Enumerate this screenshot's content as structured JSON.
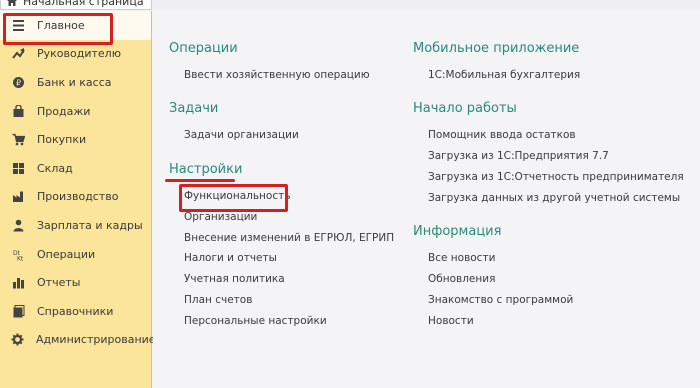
{
  "tabs": {
    "home_label": "Начальная страница"
  },
  "sidebar": {
    "items": [
      {
        "label": "Главное",
        "icon": "menu-lines-icon"
      },
      {
        "label": "Руководителю",
        "icon": "trend-up-icon"
      },
      {
        "label": "Банк и касса",
        "icon": "coin-icon"
      },
      {
        "label": "Продажи",
        "icon": "shopping-bag-icon"
      },
      {
        "label": "Покупки",
        "icon": "cart-icon"
      },
      {
        "label": "Склад",
        "icon": "warehouse-icon"
      },
      {
        "label": "Производство",
        "icon": "factory-icon"
      },
      {
        "label": "Зарплата и кадры",
        "icon": "person-icon"
      },
      {
        "label": "Операции",
        "icon": "operations-icon"
      },
      {
        "label": "Отчеты",
        "icon": "chart-bars-icon"
      },
      {
        "label": "Справочники",
        "icon": "books-icon"
      },
      {
        "label": "Администрирование",
        "icon": "gear-icon"
      }
    ]
  },
  "main": {
    "left": {
      "operations": {
        "title": "Операции",
        "links": [
          "Ввести хозяйственную операцию"
        ]
      },
      "tasks": {
        "title": "Задачи",
        "links": [
          "Задачи организации"
        ]
      },
      "settings": {
        "title": "Настройки",
        "links": [
          "Функциональность",
          "Организации",
          "Внесение изменений в ЕГРЮЛ, ЕГРИП",
          "Налоги и отчеты",
          "Учетная политика",
          "План счетов",
          "Персональные настройки"
        ]
      }
    },
    "right": {
      "mobile": {
        "title": "Мобильное приложение",
        "links": [
          "1С:Мобильная бухгалтерия"
        ]
      },
      "start": {
        "title": "Начало работы",
        "links": [
          "Помощник ввода остатков",
          "Загрузка из 1С:Предприятия 7.7",
          "Загрузка из 1С:Отчетность предпринимателя",
          "Загрузка данных из другой учетной системы"
        ]
      },
      "info": {
        "title": "Информация",
        "links": [
          "Все новости",
          "Обновления",
          "Знакомство с программой",
          "Новости"
        ]
      }
    }
  },
  "colors": {
    "section_title": "#2a8a78",
    "sidebar_bg": "#fbe59a",
    "highlight": "#d62020"
  }
}
